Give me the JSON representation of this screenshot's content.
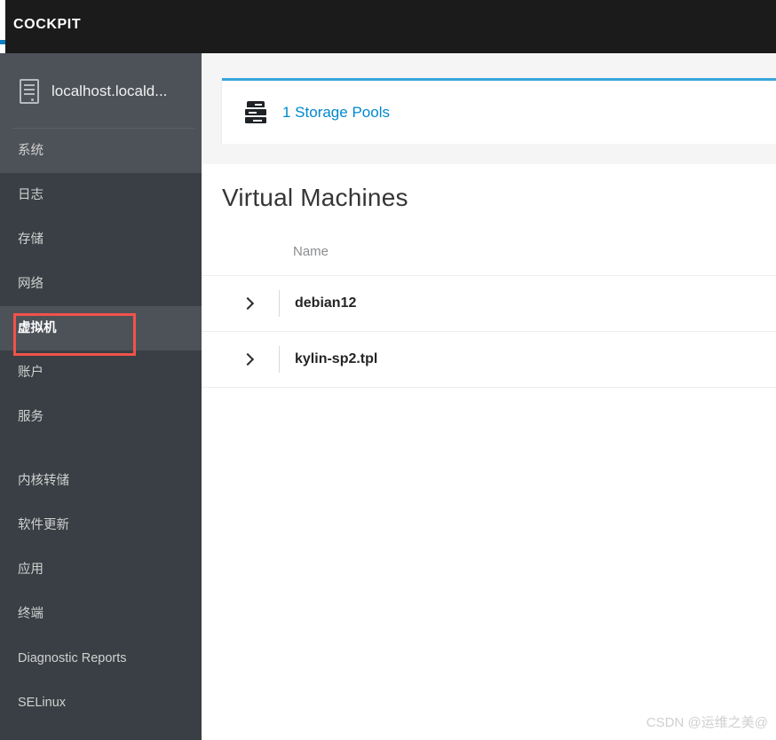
{
  "header": {
    "brand": "COCKPIT",
    "accent_color": "#0f7dc2",
    "background": "#1b1b1b"
  },
  "sidebar": {
    "background": "#393f44",
    "active_background": "#4d5258",
    "host": {
      "icon": "server-tower-icon",
      "name": "localhost.locald..."
    },
    "items": [
      {
        "label": "系统",
        "name": "system",
        "state": "highlight"
      },
      {
        "label": "日志",
        "name": "logs",
        "state": "normal"
      },
      {
        "label": "存储",
        "name": "storage",
        "state": "normal"
      },
      {
        "label": "网络",
        "name": "network",
        "state": "normal"
      },
      {
        "label": "虚拟机",
        "name": "virtual-machines",
        "state": "active"
      },
      {
        "label": "账户",
        "name": "accounts",
        "state": "normal"
      },
      {
        "label": "服务",
        "name": "services",
        "state": "normal"
      }
    ],
    "items_secondary": [
      {
        "label": "内核转储",
        "name": "kernel-dump",
        "state": "normal"
      },
      {
        "label": "软件更新",
        "name": "software-updates",
        "state": "normal"
      },
      {
        "label": "应用",
        "name": "applications",
        "state": "normal"
      },
      {
        "label": "终端",
        "name": "terminal",
        "state": "normal"
      },
      {
        "label": "Diagnostic Reports",
        "name": "diagnostic-reports",
        "state": "normal"
      },
      {
        "label": "SELinux",
        "name": "selinux",
        "state": "normal"
      }
    ],
    "annotation": {
      "target": "虚拟机",
      "color": "#f2524a"
    }
  },
  "main": {
    "storage_card": {
      "icon": "storage-pool-icon",
      "link_label": "1 Storage Pools",
      "count": "1",
      "accent_color": "#39a5dc",
      "link_color": "#0088ce"
    },
    "vm_section": {
      "title": "Virtual Machines",
      "columns": [
        "Name"
      ],
      "rows": [
        {
          "expand_icon": "chevron-right-icon",
          "name": "debian12"
        },
        {
          "expand_icon": "chevron-right-icon",
          "name": "kylin-sp2.tpl"
        }
      ]
    }
  },
  "watermark": {
    "text": "CSDN @运维之美@"
  }
}
